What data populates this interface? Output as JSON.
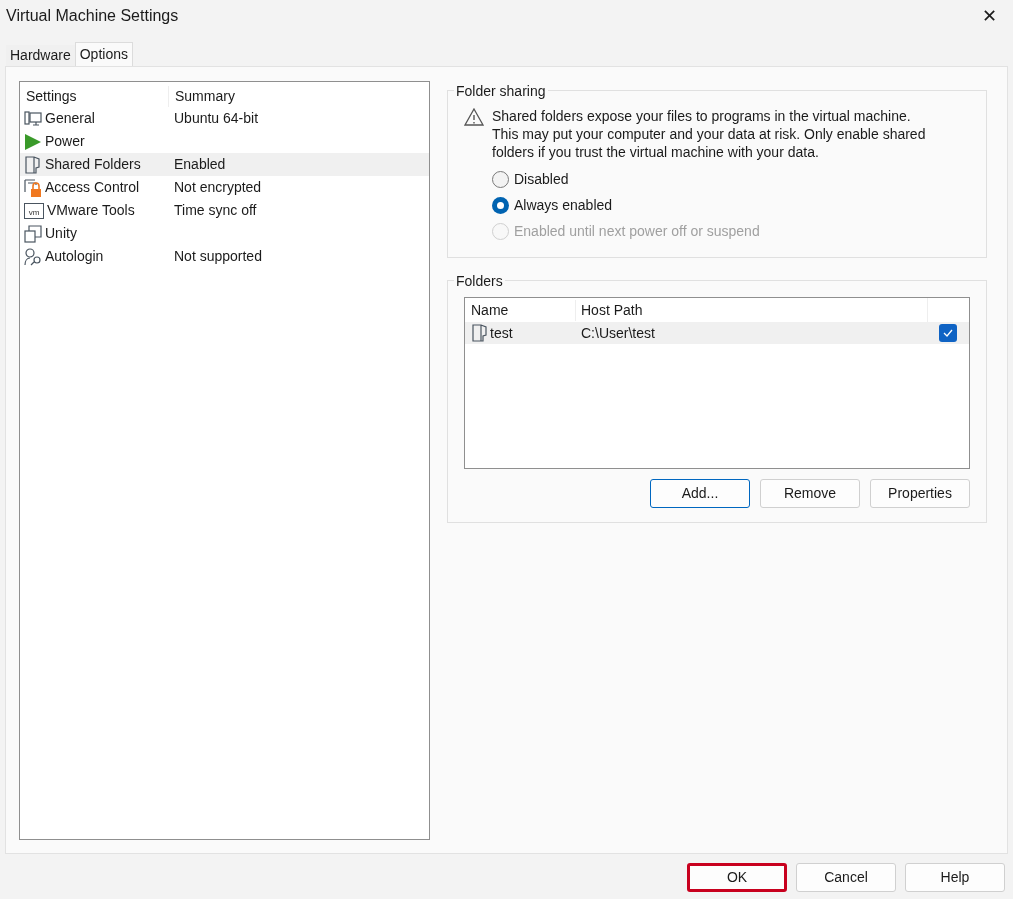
{
  "window": {
    "title": "Virtual Machine Settings",
    "close": "✕"
  },
  "tabs": [
    {
      "label": "Hardware",
      "selected": false
    },
    {
      "label": "Options",
      "selected": true
    }
  ],
  "settings_list": {
    "columns": [
      "Settings",
      "Summary"
    ],
    "rows": [
      {
        "kind": "general",
        "name": "General",
        "summary": "Ubuntu 64-bit",
        "selected": false
      },
      {
        "kind": "power",
        "name": "Power",
        "selected": false
      },
      {
        "kind": "shared",
        "name": "Shared Folders",
        "summary": "Enabled",
        "selected": true
      },
      {
        "kind": "access",
        "name": "Access Control",
        "summary": "Not encrypted",
        "selected": false
      },
      {
        "kind": "tools",
        "logo_text": "vm",
        "name": "VMware Tools",
        "summary": "Time sync off",
        "selected": false
      },
      {
        "kind": "unity",
        "name": "Unity",
        "selected": false
      },
      {
        "kind": "autologin",
        "name": "Autologin",
        "summary": "Not supported",
        "selected": false
      }
    ]
  },
  "folder_sharing": {
    "title": "Folder sharing",
    "warning": "Shared folders expose your files to programs in the virtual machine. This may put your computer and your data at risk. Only enable shared folders if you trust the virtual machine with your data.",
    "options": [
      {
        "label": "Disabled",
        "selected": false,
        "disabled": false
      },
      {
        "label": "Always enabled",
        "selected": true,
        "disabled": false
      },
      {
        "label": "Enabled until next power off or suspend",
        "selected": false,
        "disabled": true
      }
    ]
  },
  "folders": {
    "title": "Folders",
    "columns": [
      "Name",
      "Host Path"
    ],
    "rows": [
      {
        "name": "test",
        "host_path": "C:\\User\\test",
        "checked": true,
        "selected": true
      }
    ],
    "buttons": [
      {
        "label": "Add...",
        "focused": true
      },
      {
        "label": "Remove",
        "focused": false
      },
      {
        "label": "Properties",
        "focused": false
      }
    ]
  },
  "footer_buttons": [
    {
      "label": "OK",
      "highlighted": true
    },
    {
      "label": "Cancel",
      "highlighted": false
    },
    {
      "label": "Help",
      "highlighted": false
    }
  ]
}
